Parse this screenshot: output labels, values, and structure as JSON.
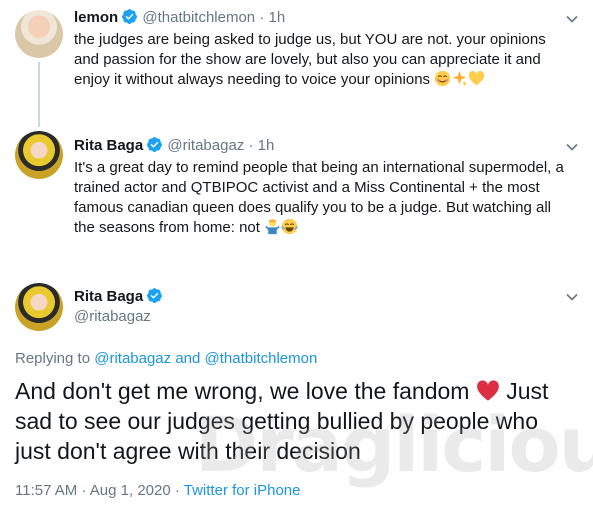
{
  "tweet1": {
    "name": "lemon",
    "handle": "@thatbitchlemon",
    "time": "1h",
    "text": "the judges are being asked to judge us, but YOU are not. your opinions and passion for the show are lovely, but also you can appreciate it and enjoy it without always needing to voice your opinions"
  },
  "tweet2": {
    "name": "Rita Baga",
    "handle": "@ritabagaz",
    "time": "1h",
    "text": "It's a great day to remind people that being an international supermodel, a trained actor and QTBIPOC activist and a Miss Continental + the most famous canadian queen does qualify you to be a judge. But watching all the seasons from home: not"
  },
  "tweet3": {
    "name": "Rita Baga",
    "handle": "@ritabagaz",
    "replying_prefix": "Replying to",
    "replying_user1": "@ritabagaz",
    "replying_and": "and",
    "replying_user2": "@thatbitchlemon",
    "text_part1": "And don't get me wrong, we love the fandom",
    "text_part2": "Just sad to see our judges getting bullied by people who just don't agree with their decision",
    "time": "11:57 AM",
    "date": "Aug 1, 2020",
    "source": "Twitter for iPhone"
  },
  "separator": "·",
  "watermark": "Draglicious",
  "colors": {
    "verified": "#1da1f2",
    "link": "#1b95e0",
    "meta": "#657786",
    "heart": "#e0245e"
  }
}
